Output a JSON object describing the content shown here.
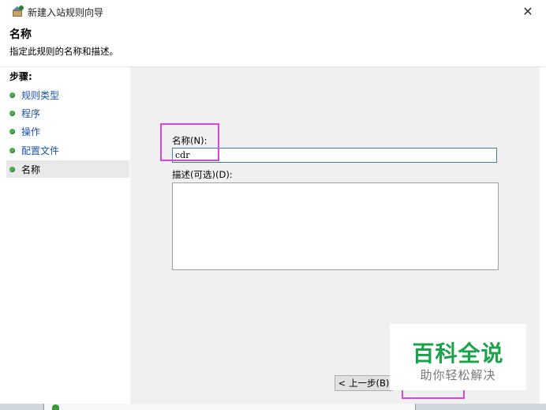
{
  "window": {
    "title": "新建入站规则向导",
    "close_glyph": "✕"
  },
  "header": {
    "heading": "名称",
    "subtitle": "指定此规则的名称和描述。"
  },
  "sidebar": {
    "title": "步骤:",
    "items": [
      {
        "label": "规则类型"
      },
      {
        "label": "程序"
      },
      {
        "label": "操作"
      },
      {
        "label": "配置文件"
      },
      {
        "label": "名称"
      }
    ]
  },
  "form": {
    "name_label": "名称(N):",
    "name_value": "cdr",
    "description_label": "描述(可选)(D):",
    "description_value": ""
  },
  "buttons": {
    "back_label": "< 上一步(B)"
  },
  "watermark": {
    "title": "百科全说",
    "subtitle": "助你轻松解决"
  },
  "colors": {
    "highlight": "#d946d9",
    "step_dot": "#4caf50",
    "link": "#1a53b0",
    "watermark_green": "#1aa34a"
  }
}
